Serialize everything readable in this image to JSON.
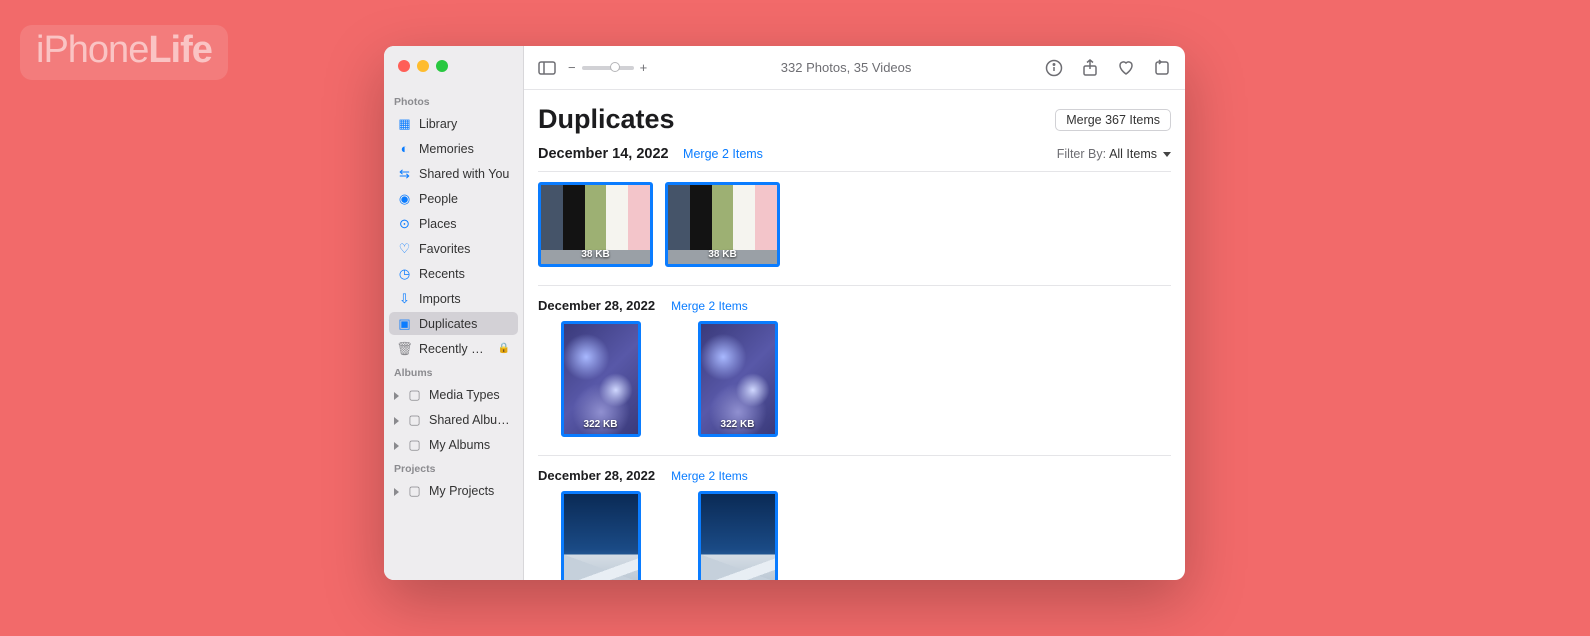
{
  "watermark": {
    "prefix": "iPhone",
    "suffix": "Life"
  },
  "toolbar": {
    "zoom_minus": "−",
    "zoom_plus": "+",
    "center_text": "332 Photos, 35 Videos"
  },
  "sidebar": {
    "sections": {
      "photos": "Photos",
      "albums": "Albums",
      "projects": "Projects"
    },
    "items": [
      {
        "label": "Library",
        "icon": "▦"
      },
      {
        "label": "Memories",
        "icon": "◐"
      },
      {
        "label": "Shared with You",
        "icon": "⇆"
      },
      {
        "label": "People",
        "icon": "◉"
      },
      {
        "label": "Places",
        "icon": "⊙"
      },
      {
        "label": "Favorites",
        "icon": "♡"
      },
      {
        "label": "Recents",
        "icon": "◷"
      },
      {
        "label": "Imports",
        "icon": "⇩"
      },
      {
        "label": "Duplicates",
        "icon": "▣"
      },
      {
        "label": "Recently D…",
        "icon": "🗑"
      }
    ],
    "album_groups": [
      {
        "label": "Media Types"
      },
      {
        "label": "Shared Albums"
      },
      {
        "label": "My Albums"
      }
    ],
    "project_groups": [
      {
        "label": "My Projects"
      }
    ]
  },
  "page": {
    "title": "Duplicates",
    "merge_all_label": "Merge 367 Items",
    "filter_prefix": "Filter By:",
    "filter_value": "All Items"
  },
  "groups": [
    {
      "date": "December 14, 2022",
      "merge_label": "Merge 2 Items",
      "thumbs": [
        {
          "kind": "swatch",
          "size": "38 KB",
          "shape": "wide"
        },
        {
          "kind": "swatch",
          "size": "38 KB",
          "shape": "wide"
        }
      ]
    },
    {
      "date": "December 28, 2022",
      "merge_label": "Merge 2 Items",
      "thumbs": [
        {
          "kind": "snowflake",
          "size": "322 KB",
          "shape": "tall"
        },
        {
          "kind": "snowflake",
          "size": "322 KB",
          "shape": "tall"
        }
      ]
    },
    {
      "date": "December 28, 2022",
      "merge_label": "Merge 2 Items",
      "thumbs": [
        {
          "kind": "mountain",
          "size": "",
          "shape": "tall"
        },
        {
          "kind": "mountain",
          "size": "",
          "shape": "tall"
        }
      ]
    }
  ]
}
